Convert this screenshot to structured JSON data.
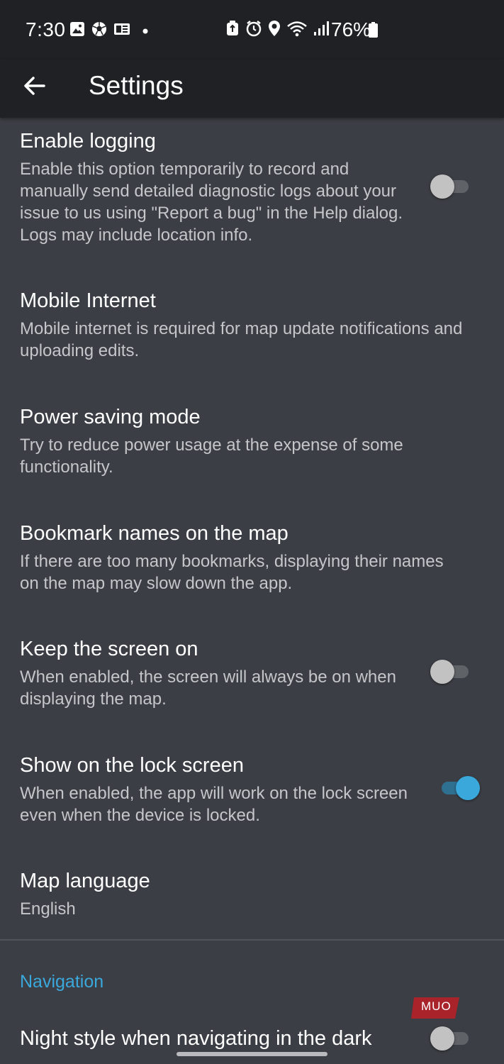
{
  "status_bar": {
    "time": "7:30",
    "battery": "76%",
    "left_icons": [
      "gallery-icon",
      "soccer-ball-icon",
      "news-icon",
      "dot-icon"
    ],
    "right_icons": [
      "recycle-icon",
      "alarm-icon",
      "location-icon",
      "wifi-icon",
      "signal-icon",
      "battery-icon"
    ]
  },
  "app_bar": {
    "title": "Settings",
    "back_icon": "arrow-left-icon"
  },
  "settings": [
    {
      "title": "Enable logging",
      "summary": "Enable this option temporarily to record and manually send detailed diagnostic logs about your issue to us using \"Report a bug\" in the Help dialog. Logs may include location info.",
      "toggle": "off"
    },
    {
      "title": "Mobile Internet",
      "summary": "Mobile internet is required for map update notifications and uploading edits."
    },
    {
      "title": "Power saving mode",
      "summary": "Try to reduce power usage at the expense of some functionality."
    },
    {
      "title": "Bookmark names on the map",
      "summary": "If there are too many bookmarks, displaying their names on the map may slow down the app."
    },
    {
      "title": "Keep the screen on",
      "summary": "When enabled, the screen will always be on when displaying the map.",
      "toggle": "off"
    },
    {
      "title": "Show on the lock screen",
      "summary": "When enabled, the app will work on the lock screen even when the device is locked.",
      "toggle": "on"
    },
    {
      "title": "Map language",
      "summary": "English"
    }
  ],
  "navigation_section": {
    "header": "Navigation",
    "items": [
      {
        "title": "Night style when navigating in the dark",
        "toggle": "off"
      }
    ]
  },
  "watermark": {
    "text": "MUO"
  },
  "colors": {
    "background": "#3b3e44",
    "app_bar": "#1f2124",
    "accent": "#3ba8dc",
    "summary_text": "#c4c6ca"
  }
}
